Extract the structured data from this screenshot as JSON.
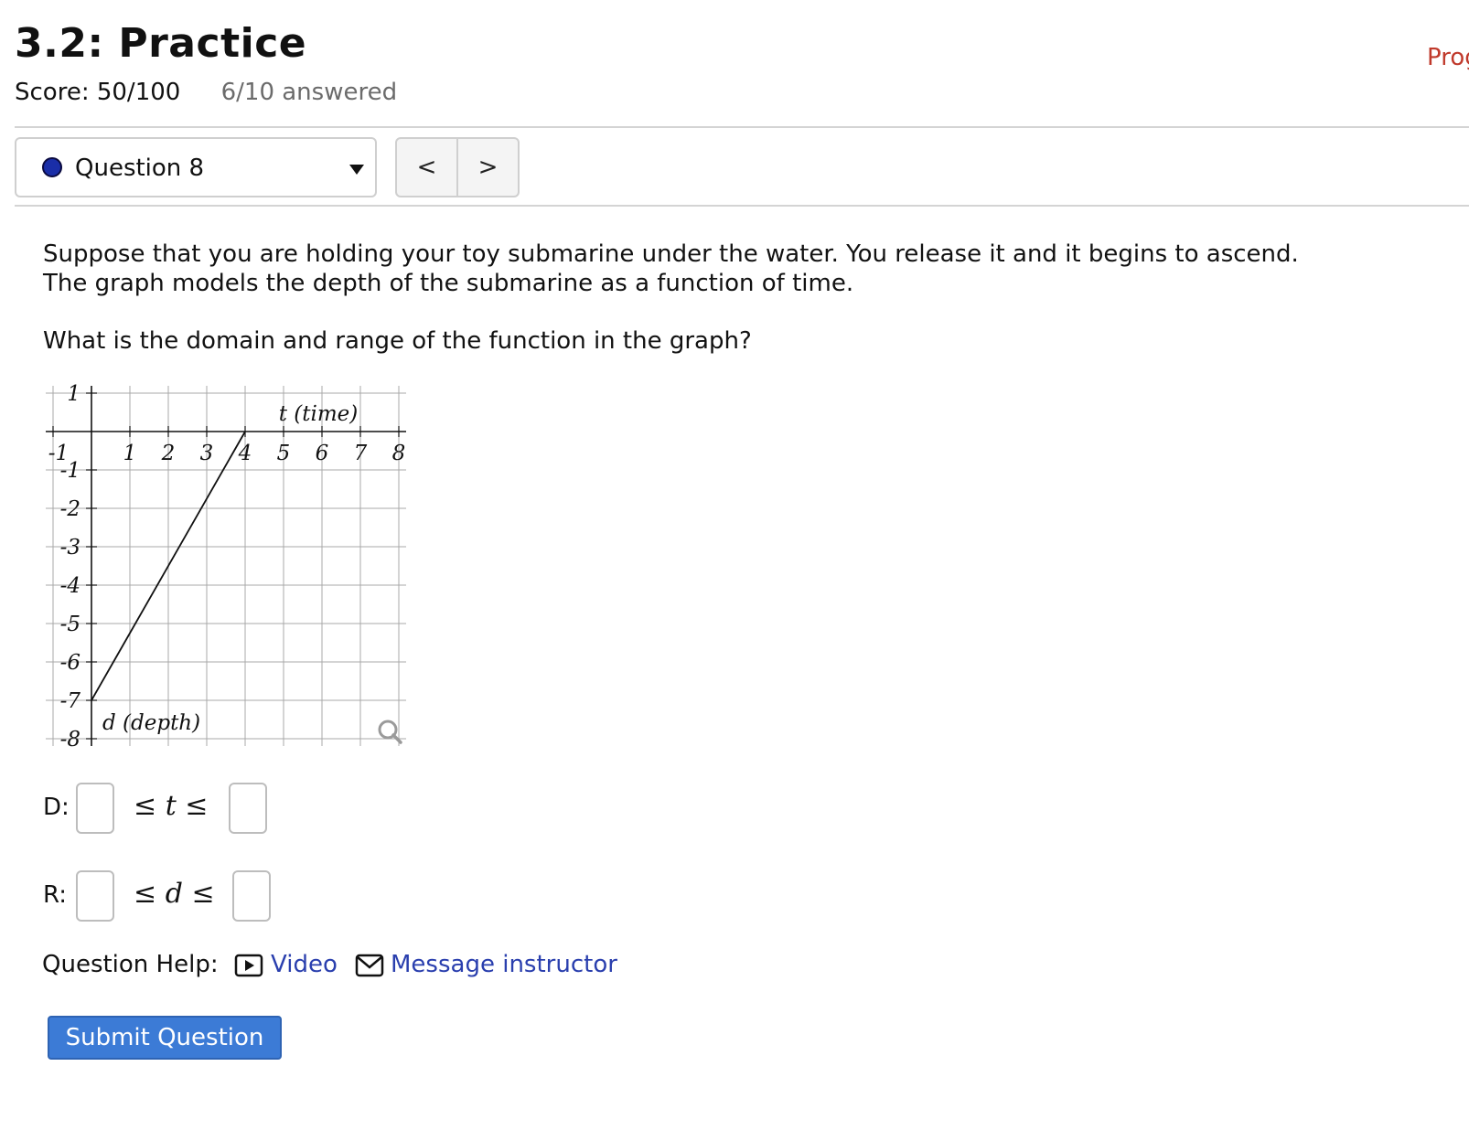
{
  "header": {
    "title": "3.2: Practice",
    "progress_link": "Prog",
    "score": "Score: 50/100",
    "answered": "6/10 answered"
  },
  "question_nav": {
    "selected_question": "Question 8",
    "status_color": "#1a2ea8",
    "prev_label": "<",
    "next_label": ">"
  },
  "question": {
    "text": "Suppose that you are holding your toy submarine under the water. You release it and it begins to ascend. The graph models the depth of the submarine as a function of time.",
    "prompt": "What is the domain and range of the function in the graph?"
  },
  "chart_data": {
    "type": "line",
    "xlabel": "t (time)",
    "ylabel": "d (depth)",
    "xlim": [
      -1,
      8
    ],
    "ylim": [
      -8,
      1
    ],
    "x_ticks": [
      "-1",
      "1",
      "2",
      "3",
      "4",
      "5",
      "6",
      "7",
      "8"
    ],
    "y_ticks": [
      "1",
      "-1",
      "-2",
      "-3",
      "-4",
      "-5",
      "-6",
      "-7",
      "-8"
    ],
    "grid": true,
    "series": [
      {
        "x": [
          0,
          4
        ],
        "y": [
          -7,
          0
        ]
      }
    ],
    "zoom_icon": "magnifier-icon"
  },
  "answers": {
    "domain_label": "D:",
    "domain_ineq_left": "≤",
    "domain_var": "t",
    "domain_ineq_right": "≤",
    "range_label": "R:",
    "range_ineq_left": "≤",
    "range_var": "d",
    "range_ineq_right": "≤"
  },
  "help": {
    "label": "Question Help:",
    "video_label": "Video",
    "video_icon": "video-play-icon",
    "message_label": "Message instructor",
    "message_icon": "envelope-icon"
  },
  "submit": {
    "label": "Submit Question",
    "color": "#3c7bd6"
  }
}
